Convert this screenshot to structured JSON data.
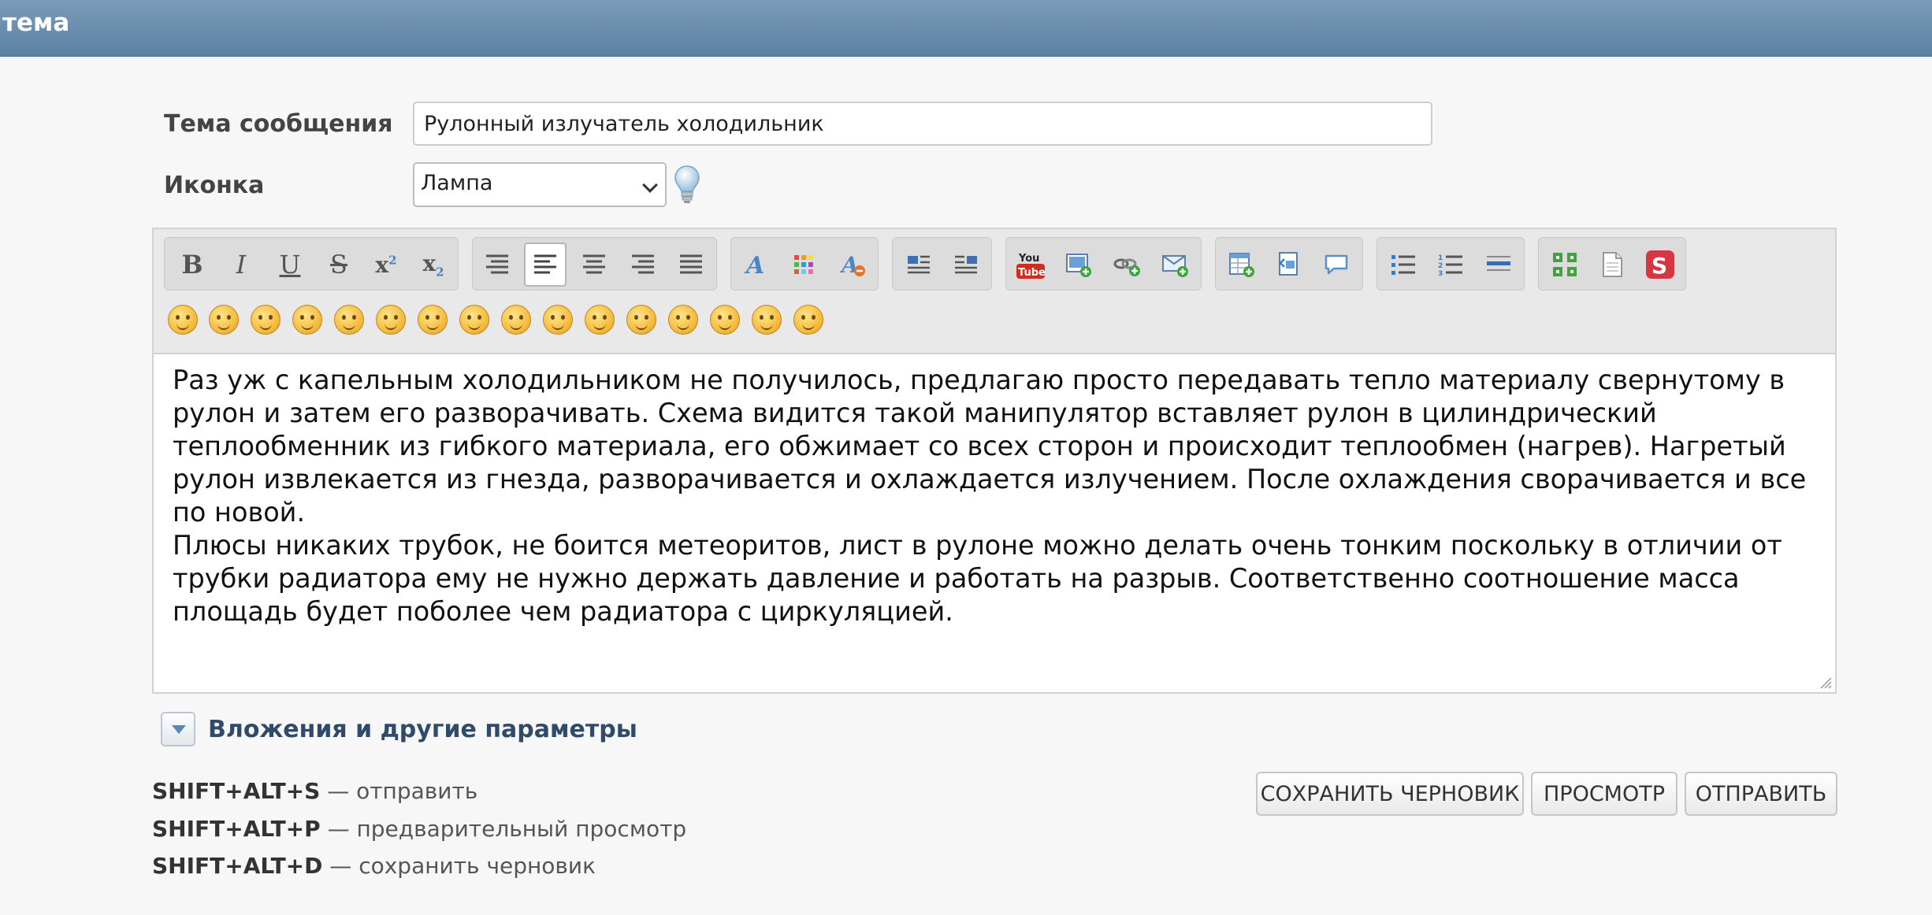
{
  "header": {
    "title": "тема"
  },
  "form": {
    "subject_label": "Тема сообщения",
    "subject_value": "Рулонный излучатель холодильник",
    "icon_label": "Иконка",
    "icon_value": "Лампа"
  },
  "toolbar": {
    "groups": [
      {
        "name": "text-format",
        "buttons": [
          "bold",
          "italic",
          "underline",
          "strikethrough",
          "superscript",
          "subscript"
        ]
      },
      {
        "name": "alignment",
        "buttons": [
          "indent",
          "align-left",
          "align-center",
          "align-right",
          "justify"
        ]
      },
      {
        "name": "font",
        "buttons": [
          "font-style",
          "color",
          "remove-format"
        ]
      },
      {
        "name": "layout",
        "buttons": [
          "float-left",
          "float-right"
        ]
      },
      {
        "name": "media",
        "buttons": [
          "youtube",
          "image",
          "link",
          "email"
        ]
      },
      {
        "name": "insert",
        "buttons": [
          "table",
          "code",
          "quote"
        ]
      },
      {
        "name": "lists",
        "buttons": [
          "bullet-list",
          "numbered-list",
          "horizontal-rule"
        ]
      },
      {
        "name": "tools",
        "buttons": [
          "fullscreen",
          "source",
          "spoiler"
        ]
      }
    ],
    "active_button": "align-left",
    "smiley_count": 16
  },
  "editor": {
    "text": "Раз уж с капельным холодильником не получилось, предлагаю просто передавать тепло материалу свернутому в рулон и затем его разворачивать. Схема видится такой манипулятор вставляет рулон в цилиндрический теплообменник из гибкого материала, его обжимает со всех сторон и происходит теплообмен (нагрев). Нагретый рулон извлекается из гнезда, разворачивается и охлаждается излучением. После охлаждения сворачивается и все по новой.\nПлюсы никаких трубок, не боится метеоритов, лист в рулоне можно делать очень тонким поскольку в отличии от трубки радиатора ему не нужно держать давление и работать на разрыв. Соответственно соотношение масса площадь будет поболее чем радиатора с циркуляцией."
  },
  "attachments": {
    "label": "Вложения и другие параметры"
  },
  "shortcuts": [
    {
      "keys": "SHIFT+ALT+S",
      "desc": "— отправить"
    },
    {
      "keys": "SHIFT+ALT+P",
      "desc": "— предварительный просмотр"
    },
    {
      "keys": "SHIFT+ALT+D",
      "desc": "— сохранить черновик"
    }
  ],
  "buttons": {
    "save_draft": "СОХРАНИТЬ ЧЕРНОВИК",
    "preview": "ПРОСМОТР",
    "send": "ОТПРАВИТЬ"
  }
}
